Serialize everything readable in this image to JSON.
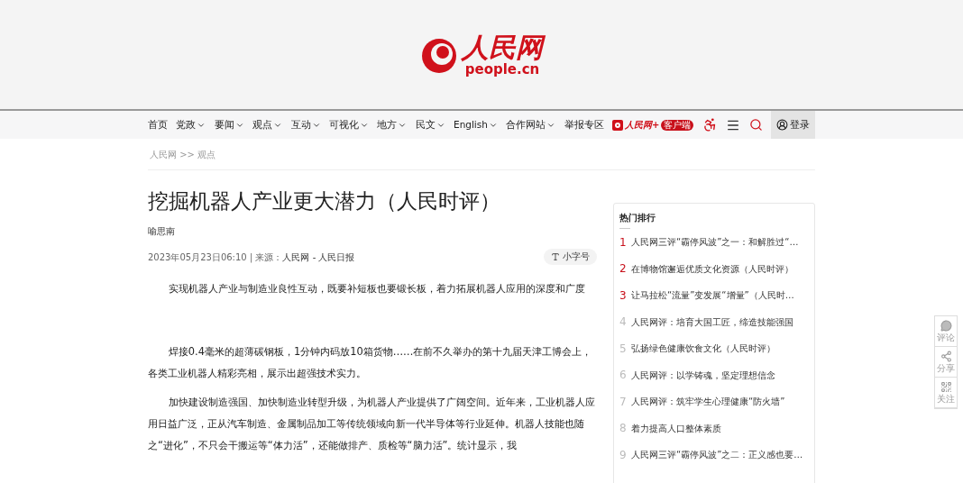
{
  "logo": {
    "name": "人民网",
    "domain": "people.cn"
  },
  "nav": {
    "items": [
      {
        "label": "首页",
        "kind": "link"
      },
      {
        "label": "党政",
        "kind": "dropdown"
      },
      {
        "label": "要闻",
        "kind": "dropdown"
      },
      {
        "label": "观点",
        "kind": "dropdown"
      },
      {
        "label": "互动",
        "kind": "dropdown"
      },
      {
        "label": "可视化",
        "kind": "dropdown"
      },
      {
        "label": "地方",
        "kind": "dropdown"
      },
      {
        "label": "民文",
        "kind": "dropdown"
      },
      {
        "label": "English",
        "kind": "dropdown"
      },
      {
        "label": "合作网站",
        "kind": "dropdown"
      },
      {
        "label": "举报专区",
        "kind": "link"
      }
    ],
    "app": {
      "name": "人民网+",
      "badge": "客户端"
    },
    "login": "登录"
  },
  "breadcrumb": "人民网 >> 观点",
  "article": {
    "title": "挖掘机器人产业更大潜力（人民时评）",
    "author": "喻思南",
    "meta": "2023年05月23日06:10 | 来源：",
    "source": "人民网 - 人民日报",
    "font_size_button": "小字号",
    "paragraphs": [
      "实现机器人产业与制造业良性互动，既要补短板也要锻长板，着力拓展机器人应用的深度和广度",
      "焊接0.4毫米的超薄碳钢板，1分钟内码放10箱货物……在前不久举办的第十九届天津工博会上，各类工业机器人精彩亮相，展示出超强技术实力。",
      "加快建设制造强国、加快制造业转型升级，为机器人产业提供了广阔空间。近年来，工业机器人应用日益广泛，正从汽车制造、金属制品加工等传统领域向新一代半导体等行业延伸。机器人技能也随之“进化”，不只会干搬运等“体力活”，还能做排产、质检等“脑力活”。统计显示，我"
    ]
  },
  "hot_list": {
    "title": "热门排行",
    "items": [
      {
        "rank": "1",
        "text": "人民网三评“霸停风波”之一：和解胜过“…",
        "highlighted": true
      },
      {
        "rank": "2",
        "text": "在博物馆邂逅优质文化资源（人民时评）",
        "highlighted": true
      },
      {
        "rank": "3",
        "text": "让马拉松“流量”变发展“增量”（人民时…",
        "highlighted": true
      },
      {
        "rank": "4",
        "text": "人民网评：培育大国工匠，缔造技能强国",
        "highlighted": false
      },
      {
        "rank": "5",
        "text": "弘扬绿色健康饮食文化（人民时评）",
        "highlighted": false
      },
      {
        "rank": "6",
        "text": "人民网评：以学铸魂，坚定理想信念",
        "highlighted": false
      },
      {
        "rank": "7",
        "text": "人民网评：筑牢学生心理健康“防火墙”",
        "highlighted": false
      },
      {
        "rank": "8",
        "text": "着力提高人口整体素质",
        "highlighted": false
      },
      {
        "rank": "9",
        "text": "人民网三评“霸停风波”之二：正义感也要…",
        "highlighted": false
      }
    ]
  },
  "side_tools": [
    {
      "label": "评论",
      "kind": "comment"
    },
    {
      "label": "分享",
      "kind": "share"
    },
    {
      "label": "关注",
      "kind": "qr"
    }
  ]
}
